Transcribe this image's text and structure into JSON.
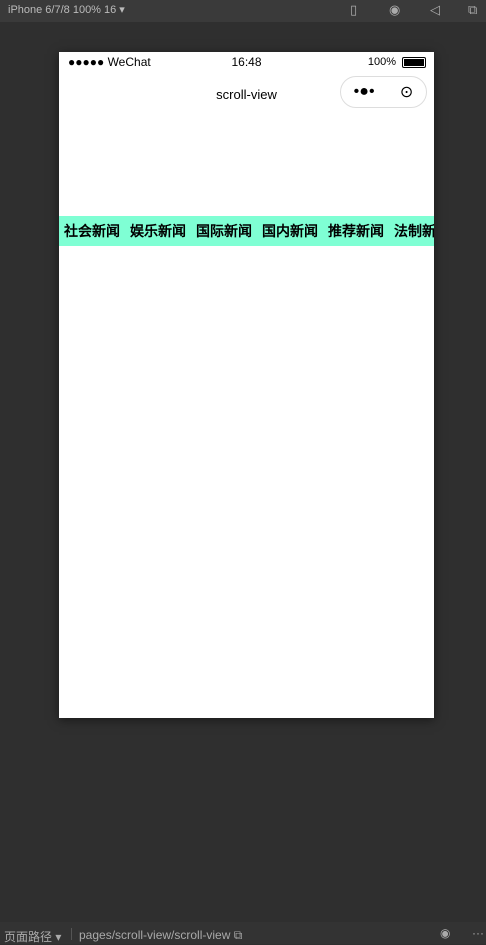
{
  "toolbar": {
    "device": "iPhone 6/7/8 100% 16 ▾",
    "icons": [
      "phone-icon",
      "record-icon",
      "sound-icon",
      "window-icon"
    ]
  },
  "status": {
    "signal": "●●●●● WeChat",
    "time": "16:48",
    "battery": "100%"
  },
  "nav": {
    "title": "scroll-view",
    "capsule_more": "•●•",
    "capsule_close": "⊙"
  },
  "scroll": {
    "background": "#7fffd4",
    "items": [
      "社会新闻",
      "娱乐新闻",
      "国际新闻",
      "国内新闻",
      "推荐新闻",
      "法制新闻"
    ]
  },
  "footer": {
    "path_label": "页面路径 ▾",
    "path": "pages/scroll-view/scroll-view",
    "copy": "⧉",
    "eye": "◉",
    "more": "···"
  }
}
